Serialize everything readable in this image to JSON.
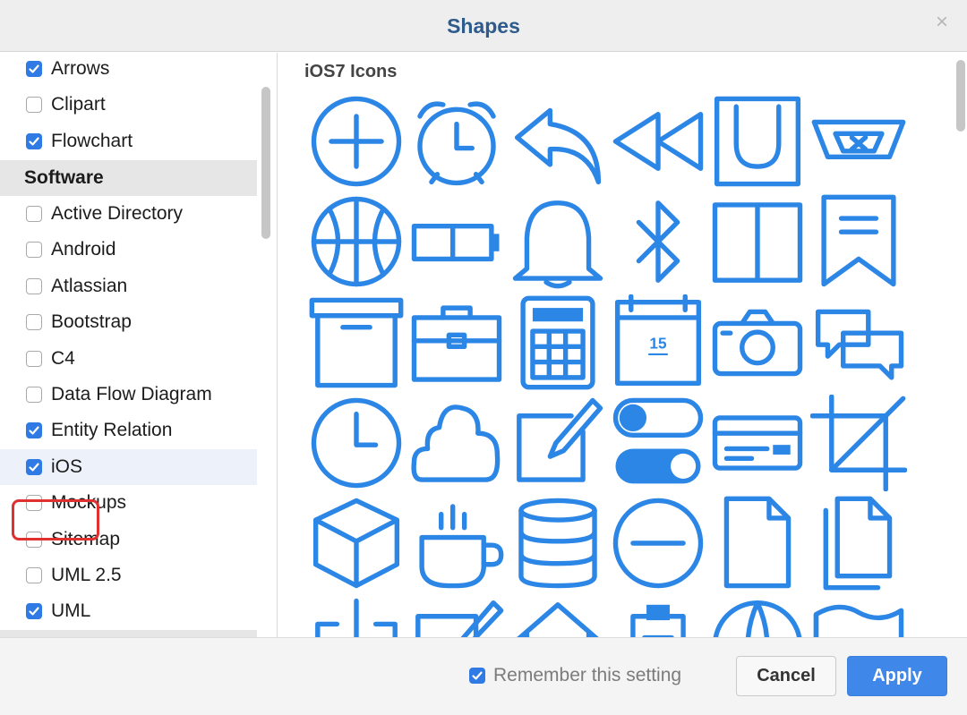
{
  "dialog": {
    "title": "Shapes",
    "close_glyph": "×"
  },
  "sidebar": {
    "section_header": "Software",
    "items": [
      {
        "label": "Arrows",
        "checked": true
      },
      {
        "label": "Clipart",
        "checked": false
      },
      {
        "label": "Flowchart",
        "checked": true
      },
      {
        "label": "Active Directory",
        "checked": false
      },
      {
        "label": "Android",
        "checked": false
      },
      {
        "label": "Atlassian",
        "checked": false
      },
      {
        "label": "Bootstrap",
        "checked": false
      },
      {
        "label": "C4",
        "checked": false
      },
      {
        "label": "Data Flow Diagram",
        "checked": false
      },
      {
        "label": "Entity Relation",
        "checked": true
      },
      {
        "label": "iOS",
        "checked": true,
        "selected": true
      },
      {
        "label": "Mockups",
        "checked": false
      },
      {
        "label": "Sitemap",
        "checked": false
      },
      {
        "label": "UML 2.5",
        "checked": false
      },
      {
        "label": "UML",
        "checked": true
      }
    ]
  },
  "main": {
    "palette_title": "iOS7 Icons",
    "icon_color": "#2c86e6",
    "calendar_day": "15",
    "icons": [
      "add-icon",
      "alarm-clock-icon",
      "reply-icon",
      "rewind-icon",
      "magnet-icon",
      "inbox-tray-icon",
      "basketball-icon",
      "battery-icon",
      "bell-icon",
      "bluetooth-icon",
      "open-book-icon",
      "bookmark-icon",
      "archive-box-icon",
      "briefcase-icon",
      "calculator-icon",
      "calendar-icon",
      "camera-icon",
      "chat-bubbles-icon",
      "clock-icon",
      "cloud-icon",
      "compose-icon",
      "toggle-switches-icon",
      "credit-card-icon",
      "crop-icon",
      "cube-icon",
      "coffee-cup-icon",
      "database-icon",
      "minus-circle-icon",
      "document-icon",
      "documents-icon",
      "download-icon",
      "edit-icon",
      "home-icon",
      "clipboard-icon",
      "globe-icon",
      "flag-icon"
    ]
  },
  "footer": {
    "remember_label": "Remember this setting",
    "remember_checked": true,
    "cancel_label": "Cancel",
    "apply_label": "Apply"
  },
  "colors": {
    "accent": "#2f7ae5",
    "apply_button": "#3f87e8",
    "highlight": "#e03030",
    "title": "#2e5a8c"
  }
}
